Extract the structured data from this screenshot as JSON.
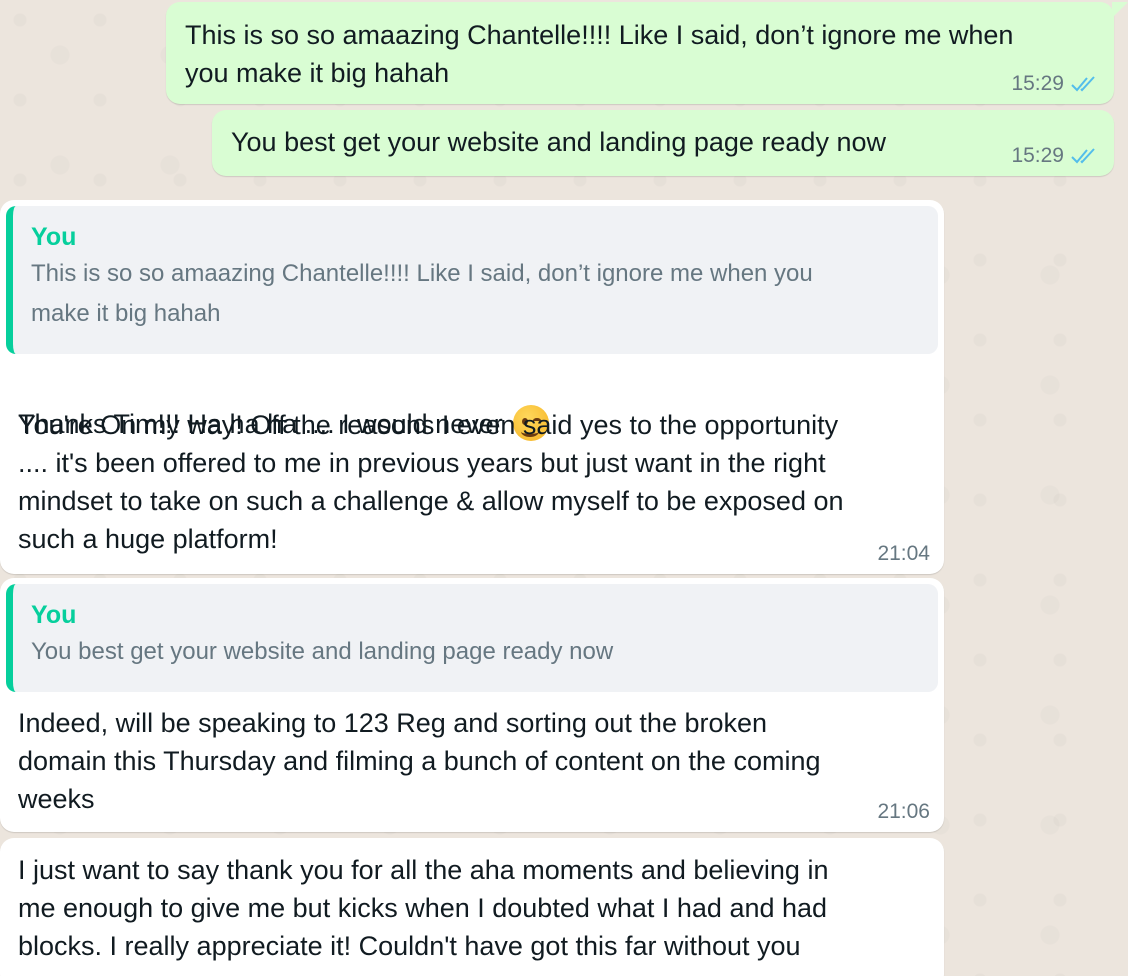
{
  "messages": [
    {
      "direction": "outgoing",
      "text": "This is so so amaazing Chantelle!!!! Like I said, don’t ignore me when\nyou make it big hahah",
      "time": "15:29",
      "status": "double-check-read"
    },
    {
      "direction": "outgoing",
      "text": "You best get your website and landing page ready now",
      "time": "15:29",
      "status": "double-check-read"
    },
    {
      "direction": "incoming",
      "quote": {
        "author": "You",
        "text": "This is so so amaazing Chantelle!!!! Like I said, don’t ignore me when you\nmake it big hahah"
      },
      "first_line": "Thanks Tim!!! Ha ha ha .... I would never",
      "emoji": "winking-face-emoji",
      "text": "You're On my way! Off the reasons I even said yes to the opportunity\n.... it's been offered to me in previous years but just want in the right\nmindset to take on such a challenge & allow myself to be exposed on\nsuch a huge platform!",
      "time": "21:04"
    },
    {
      "direction": "incoming",
      "quote": {
        "author": "You",
        "text": "You best get your website and landing page ready now"
      },
      "text": "Indeed, will be speaking to 123 Reg and sorting out the broken\ndomain this Thursday and filming a bunch of content on the coming\nweeks",
      "time": "21:06"
    },
    {
      "direction": "incoming",
      "text": "I just want to say thank you for all the aha moments and believing in\nme enough to give me but kicks when I doubted what I had and had\nblocks. I really appreciate it! Couldn't have got this far without you"
    }
  ],
  "colors": {
    "outgoing_bubble": "#d9fdd3",
    "incoming_bubble": "#ffffff",
    "quote_accent": "#06cf9c",
    "read_ticks": "#53bdeb",
    "meta_text": "#667781"
  }
}
